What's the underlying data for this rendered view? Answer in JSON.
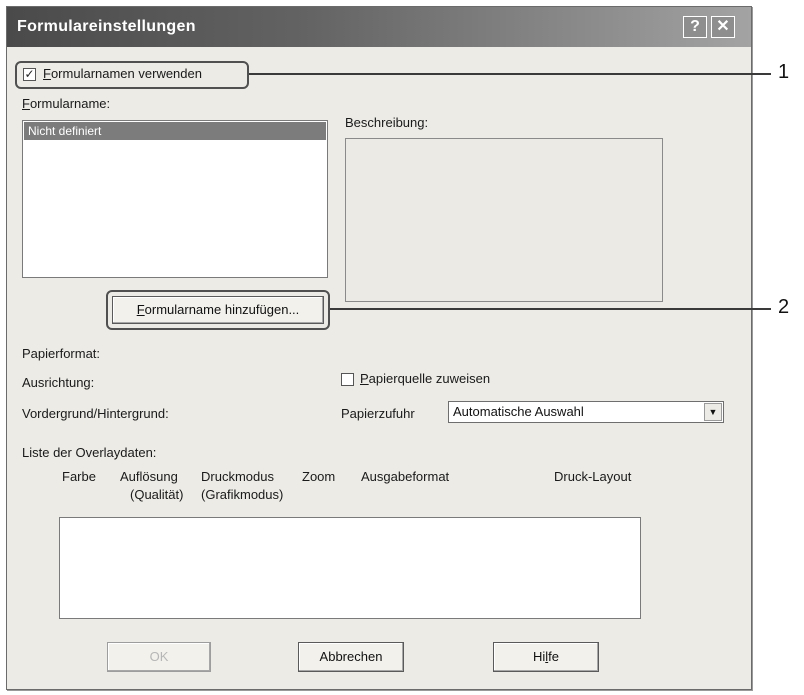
{
  "window": {
    "title": "Formulareinstellungen",
    "help_button": "?",
    "close_button": "✕"
  },
  "use_form_names": {
    "checked": true,
    "check_mark": "✓",
    "label_first": "F",
    "label_rest": "ormularnamen verwenden"
  },
  "form_name": {
    "label_first": "F",
    "label_rest": "ormularname:",
    "items": [
      "Nicht definiert"
    ]
  },
  "description": {
    "label": "Beschreibung:"
  },
  "add_form_name_button": {
    "label_first": "F",
    "label_rest": "ormularname hinzufügen..."
  },
  "paper_format": {
    "label": "Papierformat:"
  },
  "orientation": {
    "label": "Ausrichtung:"
  },
  "foreground_background": {
    "label": "Vordergrund/Hintergrund:"
  },
  "assign_paper_source": {
    "checked": false,
    "label_first": "P",
    "label_rest": "apierquelle zuweisen"
  },
  "paper_feed": {
    "label": "Papierzufuhr",
    "value": "Automatische Auswahl",
    "arrow": "▼"
  },
  "overlay_list": {
    "label": "Liste der Overlaydaten:",
    "columns": {
      "color": "Farbe",
      "resolution": "Auflösung",
      "resolution_sub": "(Qualität)",
      "print_mode": "Druckmodus",
      "print_mode_sub": "(Grafikmodus)",
      "zoom": "Zoom",
      "output_format": "Ausgabeformat",
      "print_layout": "Druck-Layout"
    }
  },
  "footer": {
    "ok": "OK",
    "cancel": "Abbrechen",
    "help_first": "Hi",
    "help_ul": "l",
    "help_rest": "fe"
  },
  "callouts": [
    "1",
    "2"
  ]
}
